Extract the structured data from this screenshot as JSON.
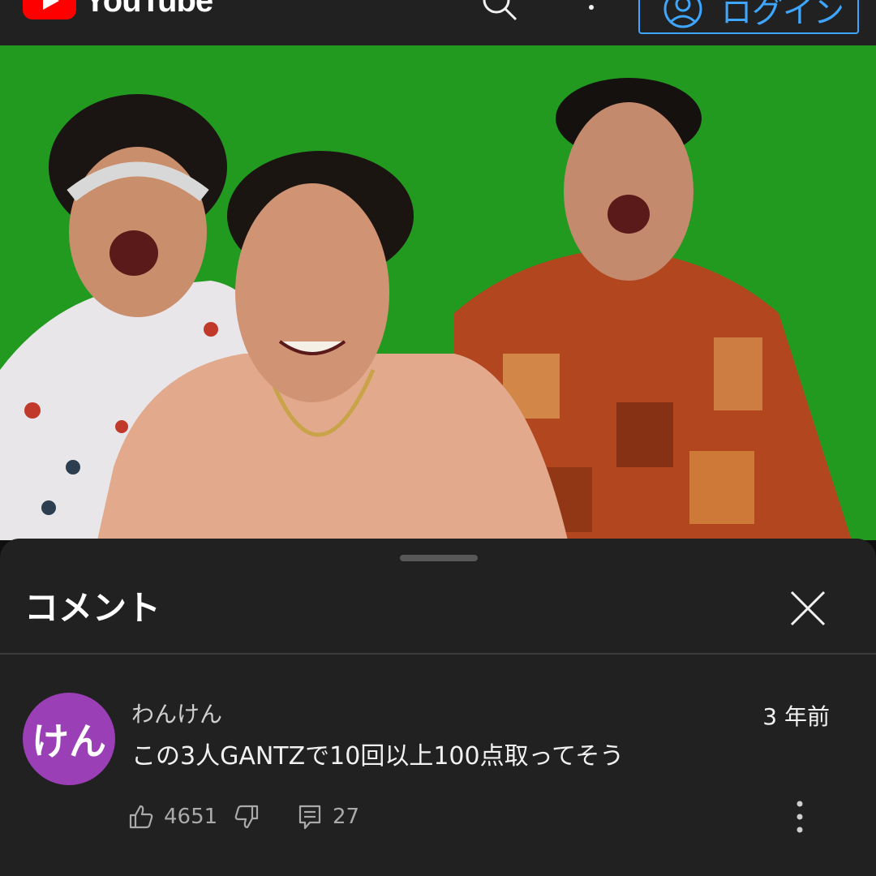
{
  "header": {
    "logo_text": "YouTube",
    "signin_label": "ログイン",
    "accent_color": "#3ea6ff",
    "brand_color": "#ff0000"
  },
  "video": {
    "background_color": "#229a20"
  },
  "comments_sheet": {
    "title": "コメント",
    "comment": {
      "avatar_text": "けん",
      "avatar_color": "#9a3fb5",
      "author": "わんけん",
      "timestamp": "3 年前",
      "text": "この3人GANTZで10回以上100点取ってそう",
      "like_count": "4651",
      "reply_count": "27"
    }
  },
  "icons": [
    "youtube-logo-icon",
    "search-icon",
    "more-vert-icon",
    "account-icon",
    "close-icon",
    "thumbs-up-icon",
    "thumbs-down-icon",
    "reply-icon"
  ]
}
